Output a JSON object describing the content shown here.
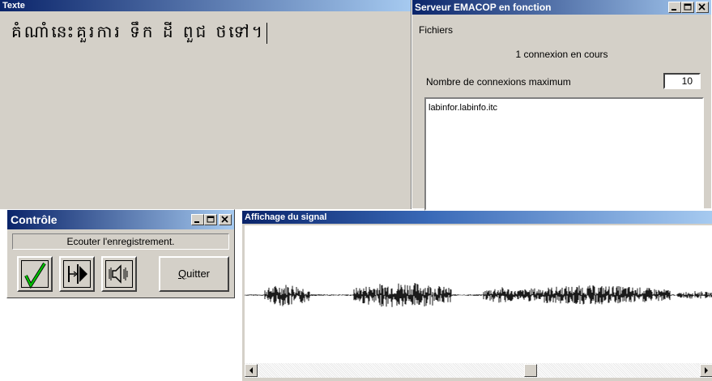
{
  "texte": {
    "title": "Texte",
    "content": "គំណាំនេះគួរការ ទឹក ដី ពួជ ថទៅ។"
  },
  "serveur": {
    "title": "Serveur EMACOP en fonction",
    "menu_fichiers": "Fichiers",
    "connexions_status": "1 connexion en cours",
    "max_label": "Nombre de connexions maximum",
    "max_value": "10",
    "clients": [
      "labinfor.labinfo.itc"
    ]
  },
  "controle": {
    "title": "Contrôle",
    "status": "Ecouter l'enregistrement.",
    "quit_label_first": "Q",
    "quit_label_rest": "uitter"
  },
  "signal": {
    "title": "Affichage du signal",
    "scroll_position": 0.62
  },
  "colors": {
    "titlebar_active": "#0a246a",
    "titlebar_gradient_end": "#a6caf0",
    "window_face": "#d4d0c8",
    "check_green": "#00a000"
  },
  "icons": {
    "minimize": "minimize-icon",
    "maximize": "maximize-icon",
    "close": "close-icon",
    "validate": "checkmark-icon",
    "play": "play-icon",
    "speaker": "speaker-icon"
  }
}
